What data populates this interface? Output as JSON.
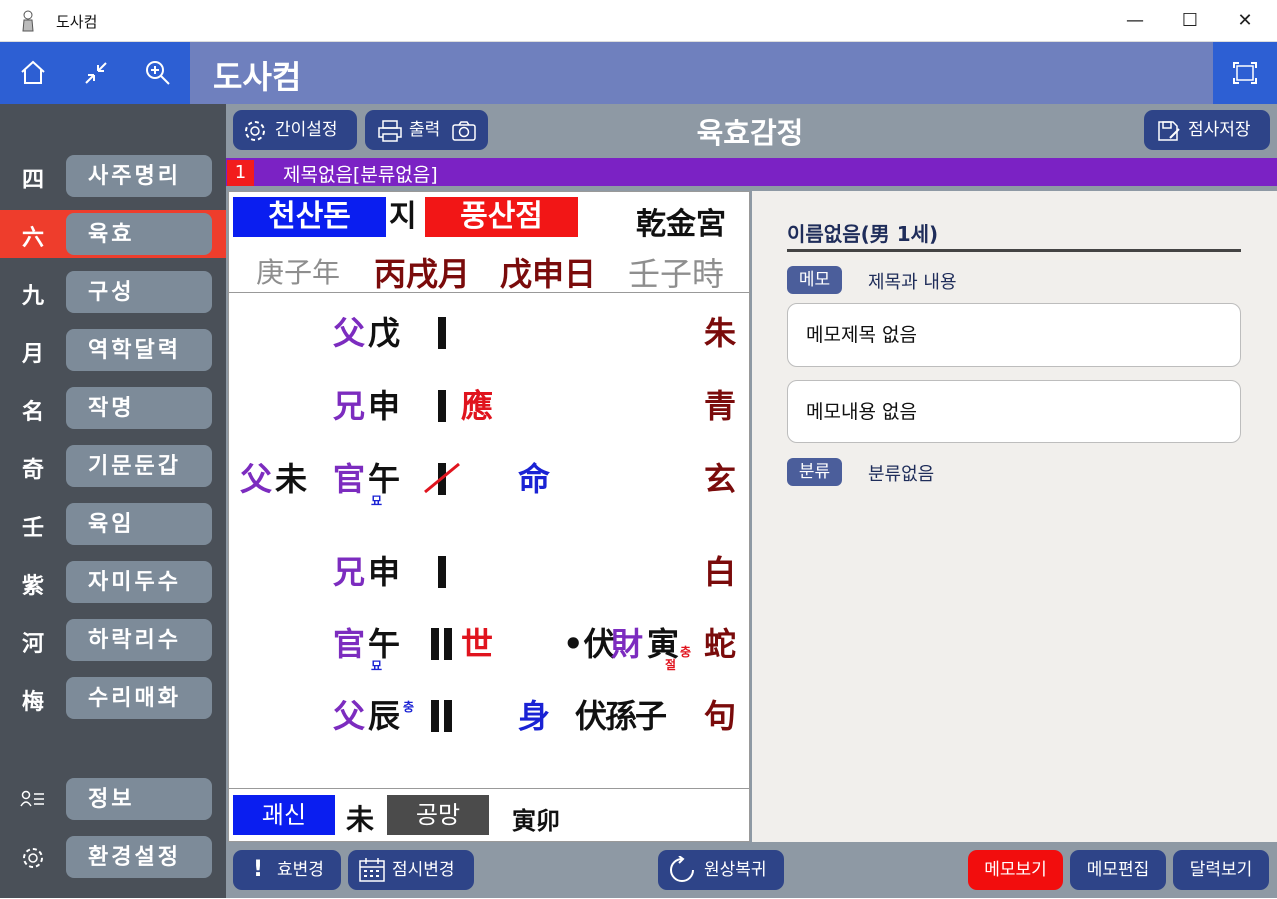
{
  "window": {
    "title": "도사컴",
    "controls": [
      "—",
      "☐",
      "✕"
    ]
  },
  "header": {
    "app_title": "도사컴"
  },
  "sidebar": {
    "items": [
      {
        "hanja": "四",
        "label": "사주명리"
      },
      {
        "hanja": "六",
        "label": "육효"
      },
      {
        "hanja": "九",
        "label": "구성"
      },
      {
        "hanja": "月",
        "label": "역학달력"
      },
      {
        "hanja": "名",
        "label": "작명"
      },
      {
        "hanja": "奇",
        "label": "기문둔갑"
      },
      {
        "hanja": "壬",
        "label": "육임"
      },
      {
        "hanja": "紫",
        "label": "자미두수"
      },
      {
        "hanja": "河",
        "label": "하락리수"
      },
      {
        "hanja": "梅",
        "label": "수리매화"
      }
    ],
    "info_label": "정보",
    "settings_label": "환경설정",
    "active": "육효"
  },
  "toolbar": {
    "setup_label": "간이설정",
    "print_label": "출력",
    "heading": "육효감정",
    "save_label": "점사저장"
  },
  "document": {
    "number": "1",
    "title": "제목없음[분류없음]"
  },
  "reading": {
    "gua1": "천산돈",
    "ji": "지",
    "gua2": "풍산점",
    "palace": "乾金宮",
    "dates": [
      "庚子年",
      "丙戌月",
      "戊申日",
      "壬子時"
    ],
    "lines": [
      {
        "hidden_rel": "",
        "hidden_br": "",
        "rel": "父",
        "branch": "戊",
        "mark": "",
        "sub": "",
        "note": "",
        "gods": "朱",
        "extra": ""
      },
      {
        "hidden_rel": "",
        "hidden_br": "",
        "rel": "兄",
        "branch": "申",
        "mark": "應",
        "sub": "",
        "note": "",
        "gods": "青",
        "extra": ""
      },
      {
        "hidden_rel": "父",
        "hidden_br": "未",
        "rel": "官",
        "branch": "午",
        "mark": "",
        "sub": "묘",
        "note": "命",
        "gods": "玄",
        "extra": ""
      },
      {
        "hidden_rel": "",
        "hidden_br": "",
        "rel": "兄",
        "branch": "申",
        "mark": "",
        "sub": "",
        "note": "",
        "gods": "白",
        "extra": ""
      },
      {
        "hidden_rel": "",
        "hidden_br": "",
        "rel": "官",
        "branch": "午",
        "mark": "世",
        "sub": "묘",
        "note": "•伏",
        "gods": "蛇",
        "extra": "財",
        "extra_br": "寅",
        "extra_sub1": "충",
        "extra_sub2": "절"
      },
      {
        "hidden_rel": "",
        "hidden_br": "",
        "rel": "父",
        "branch": "辰",
        "mark": "",
        "sub": "충",
        "note": "身",
        "gods": "句",
        "extra": "伏孫子"
      }
    ],
    "gwaesin_label": "괘신",
    "gwaesin_val": "未",
    "gongmang_label": "공망",
    "gongmang_val": "寅卯"
  },
  "memo": {
    "person": "이름없음(男 1세)",
    "memo_tag": "메모",
    "memo_hint": "제목과 내용",
    "title_box": "메모제목 없음",
    "content_box": "메모내용 없음",
    "cat_tag": "분류",
    "cat_val": "분류없음"
  },
  "bottom": {
    "change_line": "효변경",
    "change_time": "점시변경",
    "reset": "원상복귀",
    "view_memo": "메모보기",
    "edit_memo": "메모편집",
    "view_cal": "달력보기"
  },
  "colors": {
    "accent": "#2e4488",
    "active": "#ee3d2c",
    "purple": "#7b22c4",
    "topbar": "#6f80be"
  }
}
